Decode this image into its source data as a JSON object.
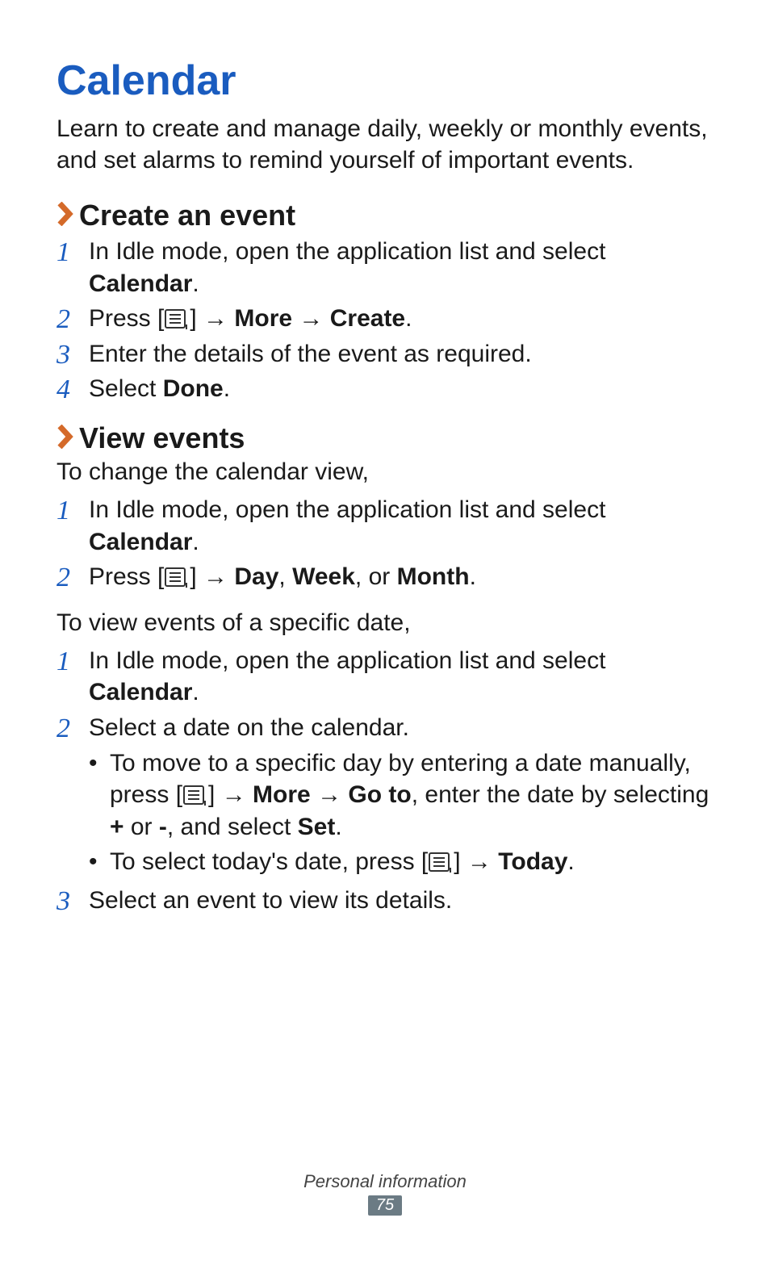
{
  "title": "Calendar",
  "intro": "Learn to create and manage daily, weekly or monthly events, and set alarms to remind yourself of important events.",
  "sections": {
    "create": {
      "heading": "Create an event",
      "steps": {
        "s1a": "In Idle mode, open the application list and select ",
        "s1b": "Calendar",
        "s1c": ".",
        "s2a": "Press [",
        "s2b": "] → ",
        "s2c": "More",
        "s2d": " → ",
        "s2e": "Create",
        "s2f": ".",
        "s3": "Enter the details of the event as required.",
        "s4a": "Select ",
        "s4b": "Done",
        "s4c": "."
      }
    },
    "view": {
      "heading": "View events",
      "sub1": "To change the calendar view,",
      "steps1": {
        "s1a": "In Idle mode, open the application list and select ",
        "s1b": "Calendar",
        "s1c": ".",
        "s2a": "Press [",
        "s2b": "] → ",
        "s2c": "Day",
        "s2d": ", ",
        "s2e": "Week",
        "s2f": ", or ",
        "s2g": "Month",
        "s2h": "."
      },
      "sub2": "To view events of a specific date,",
      "steps2": {
        "s1a": "In Idle mode, open the application list and select ",
        "s1b": "Calendar",
        "s1c": ".",
        "s2": "Select a date on the calendar.",
        "b1a": "To move to a specific day by entering a date manually, press [",
        "b1b": "] → ",
        "b1c": "More",
        "b1d": " → ",
        "b1e": "Go to",
        "b1f": ", enter the date by selecting ",
        "b1g": "+",
        "b1h": " or ",
        "b1i": "-",
        "b1j": ", and select ",
        "b1k": "Set",
        "b1l": ".",
        "b2a": "To select today's date, press [",
        "b2b": "] → ",
        "b2c": "Today",
        "b2d": ".",
        "s3": "Select an event to view its details."
      }
    }
  },
  "footer": {
    "section": "Personal information",
    "page": "75"
  },
  "nums": {
    "n1": "1",
    "n2": "2",
    "n3": "3",
    "n4": "4"
  }
}
